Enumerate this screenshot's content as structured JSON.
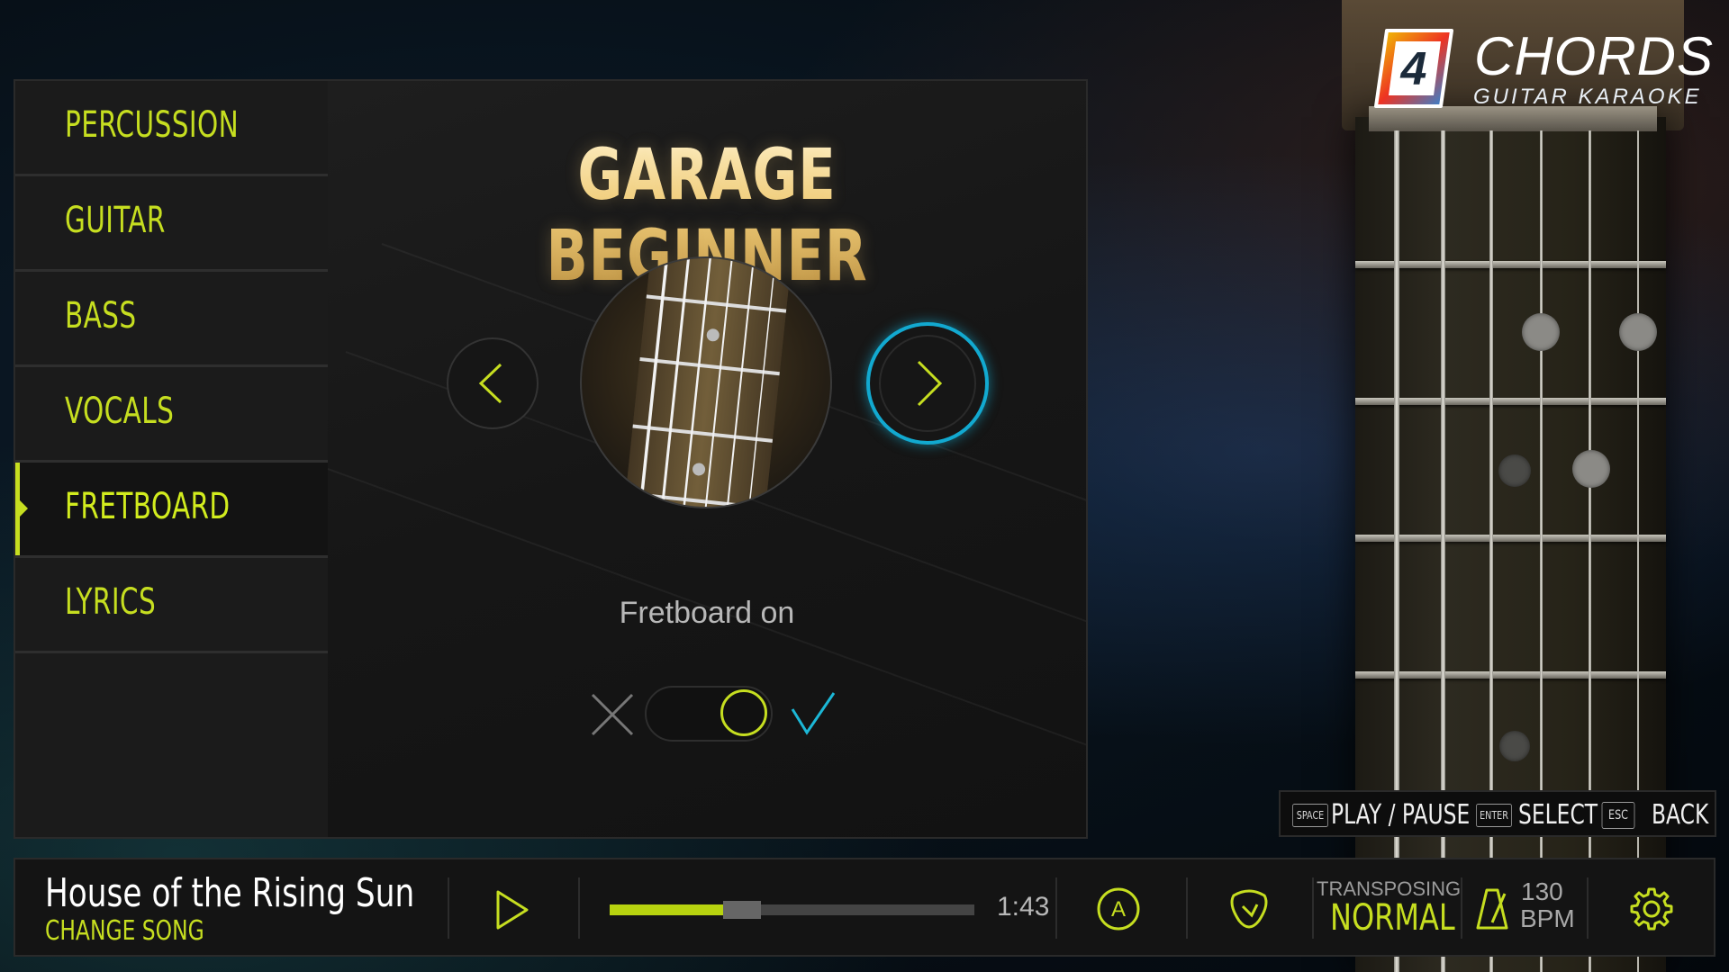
{
  "logo": {
    "number": "4",
    "title": "CHORDS",
    "subtitle": "GUITAR KARAOKE"
  },
  "sidebar": {
    "items": [
      {
        "label": "PERCUSSION",
        "active": false
      },
      {
        "label": "GUITAR",
        "active": false
      },
      {
        "label": "BASS",
        "active": false
      },
      {
        "label": "VOCALS",
        "active": false
      },
      {
        "label": "FRETBOARD",
        "active": true
      },
      {
        "label": "LYRICS",
        "active": false
      }
    ]
  },
  "preset": {
    "title": "GARAGE BEGINNER",
    "option_label": "Fretboard on",
    "toggle_on": true
  },
  "hints": [
    {
      "key": "SPACE",
      "label": "PLAY / PAUSE"
    },
    {
      "key": "ENTER",
      "label": "SELECT"
    },
    {
      "key": "ESC",
      "label": "BACK"
    }
  ],
  "player": {
    "song_title": "House of the Rising Sun",
    "change_song": "CHANGE SONG",
    "progress_fraction": 0.32,
    "time": "1:43",
    "auto_mode_letter": "A",
    "transposing_label": "TRANSPOSING",
    "transposing_value": "NORMAL",
    "bpm_value": "130",
    "bpm_unit": "BPM"
  },
  "colors": {
    "accent": "#c6de20",
    "focus_ring": "#12a9d0",
    "title_gold": "#f0cd7a"
  }
}
